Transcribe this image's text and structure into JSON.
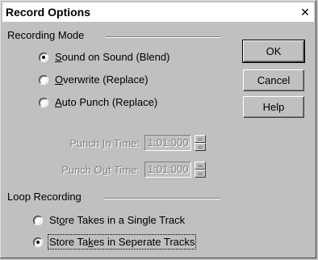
{
  "dialog": {
    "title": "Record Options",
    "close_glyph": "✕"
  },
  "recording_mode": {
    "label": "Recording Mode",
    "options": [
      {
        "prefix": "",
        "key": "S",
        "rest": "ound on Sound (Blend)",
        "checked": true
      },
      {
        "prefix": "",
        "key": "O",
        "rest": "verwrite (Replace)",
        "checked": false
      },
      {
        "prefix": "",
        "key": "A",
        "rest": "uto Punch (Replace)",
        "checked": false
      }
    ],
    "punch_in": {
      "label_pre": "Punch ",
      "label_key": "I",
      "label_post": "n Time:",
      "value": "1:01:000"
    },
    "punch_out": {
      "label_pre": "Punch O",
      "label_key": "u",
      "label_post": "t Time:",
      "value": "1:01:000"
    }
  },
  "loop_recording": {
    "label": "Loop Recording",
    "options": [
      {
        "prefix": "St",
        "key": "o",
        "rest": "re Takes in a Single Track",
        "checked": false
      },
      {
        "prefix": "Store Ta",
        "key": "k",
        "rest": "es in Seperate Tracks",
        "checked": true
      }
    ]
  },
  "buttons": {
    "ok": "OK",
    "cancel": "Cancel",
    "help": "Help"
  }
}
